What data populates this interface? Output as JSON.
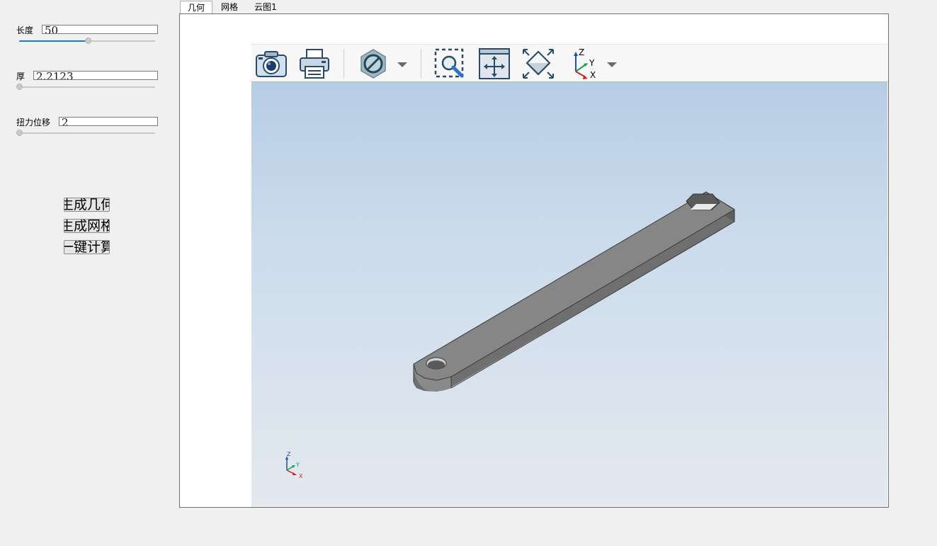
{
  "params": {
    "length": {
      "label": "长度",
      "value": "50",
      "slider_fraction": 0.48
    },
    "thickness": {
      "label": "厚",
      "value": "2.2123",
      "slider_fraction": 0.0
    },
    "torque": {
      "label": "扭力位移",
      "value": "2",
      "slider_fraction": 0.0
    }
  },
  "buttons": {
    "gen_geometry": "生成几何",
    "gen_mesh": "生成网格",
    "one_click_calc": "一键计算"
  },
  "tabs": [
    {
      "label": "几何",
      "active": true
    },
    {
      "label": "网格",
      "active": false
    },
    {
      "label": "云图1",
      "active": false
    }
  ],
  "toolbar": {
    "icons": [
      "camera-icon",
      "print-icon",
      "visibility-icon",
      "dropdown-arrow-icon",
      "zoom-box-icon",
      "pan-icon",
      "fit-view-icon",
      "axis-view-icon",
      "dropdown-arrow-icon"
    ],
    "axis_labels": {
      "z": "Z",
      "y": "Y",
      "x": "X"
    }
  },
  "triad": {
    "z": "Z",
    "y": "Y",
    "x": "X"
  },
  "colors": {
    "accent": "#1979ca",
    "model": "#7a7a7a",
    "axis_x": "#d42020",
    "axis_y": "#17a34a",
    "axis_z": "#1d4fa8"
  }
}
